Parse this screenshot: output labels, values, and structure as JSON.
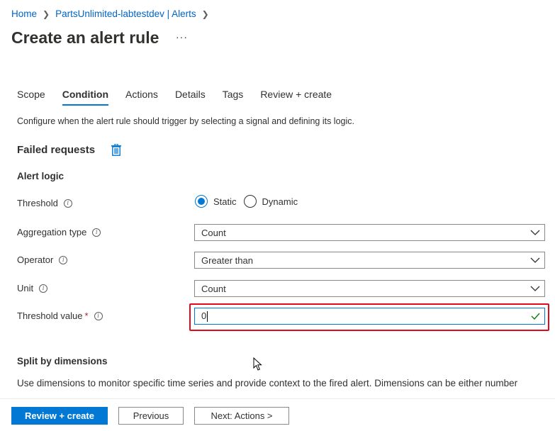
{
  "breadcrumb": {
    "items": [
      "Home",
      "PartsUnlimited-labtestdev | Alerts"
    ]
  },
  "page": {
    "title": "Create an alert rule",
    "more": "···"
  },
  "tabs": [
    "Scope",
    "Condition",
    "Actions",
    "Details",
    "Tags",
    "Review + create"
  ],
  "active_tab": "Condition",
  "description": "Configure when the alert rule should trigger by selecting a signal and defining its logic.",
  "signal": {
    "name": "Failed requests",
    "delete_icon": "trash-icon"
  },
  "alert_logic": {
    "title": "Alert logic",
    "threshold": {
      "label": "Threshold",
      "options": [
        "Static",
        "Dynamic"
      ],
      "selected": "Static"
    },
    "aggregation_type": {
      "label": "Aggregation type",
      "value": "Count"
    },
    "operator": {
      "label": "Operator",
      "value": "Greater than"
    },
    "unit": {
      "label": "Unit",
      "value": "Count"
    },
    "threshold_value": {
      "label": "Threshold value",
      "required_mark": "*",
      "value": "0"
    }
  },
  "split": {
    "title": "Split by dimensions",
    "description": "Use dimensions to monitor specific time series and provide context to the fired alert. Dimensions can be either number"
  },
  "footer": {
    "review_create": "Review + create",
    "previous": "Previous",
    "next": "Next: Actions >"
  },
  "colors": {
    "accent": "#0078d4",
    "link": "#0064c8",
    "highlight": "#e00b1c",
    "valid": "#107c10"
  }
}
